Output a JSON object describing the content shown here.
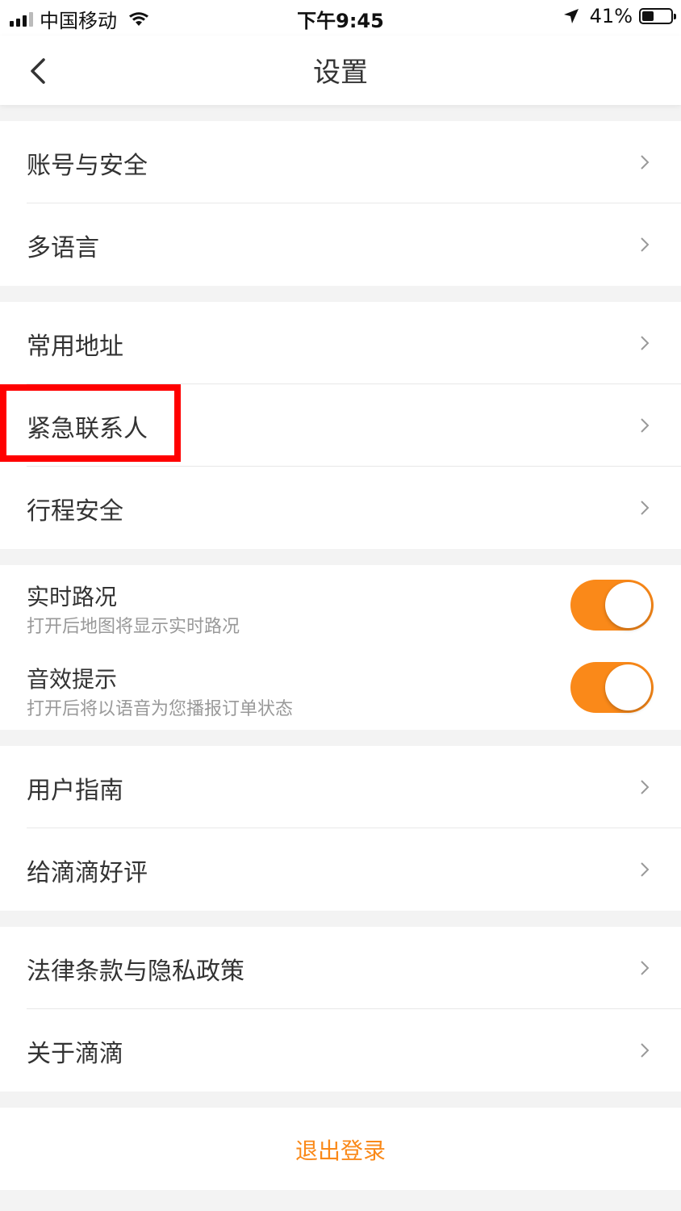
{
  "status_bar": {
    "carrier": "中国移动",
    "time": "下午9:45",
    "battery_percent": "41%",
    "battery_level": 0.41,
    "icons": [
      "signal-icon",
      "wifi-icon",
      "location-arrow-icon",
      "battery-icon"
    ]
  },
  "nav": {
    "title": "设置",
    "back_icon": "chevron-left-icon"
  },
  "groups": {
    "account": [
      "账号与安全",
      "多语言"
    ],
    "safety": [
      "常用地址",
      "紧急联系人",
      "行程安全"
    ],
    "toggles": [
      {
        "title": "实时路况",
        "subtitle": "打开后地图将显示实时路况",
        "on": true
      },
      {
        "title": "音效提示",
        "subtitle": "打开后将以语音为您播报订单状态",
        "on": true
      }
    ],
    "help": [
      "用户指南",
      "给滴滴好评"
    ],
    "about": [
      "法律条款与隐私政策",
      "关于滴滴"
    ]
  },
  "logout_label": "退出登录",
  "colors": {
    "accent": "#fa8919",
    "highlight": "#ff0000",
    "background": "#f3f3f3"
  }
}
